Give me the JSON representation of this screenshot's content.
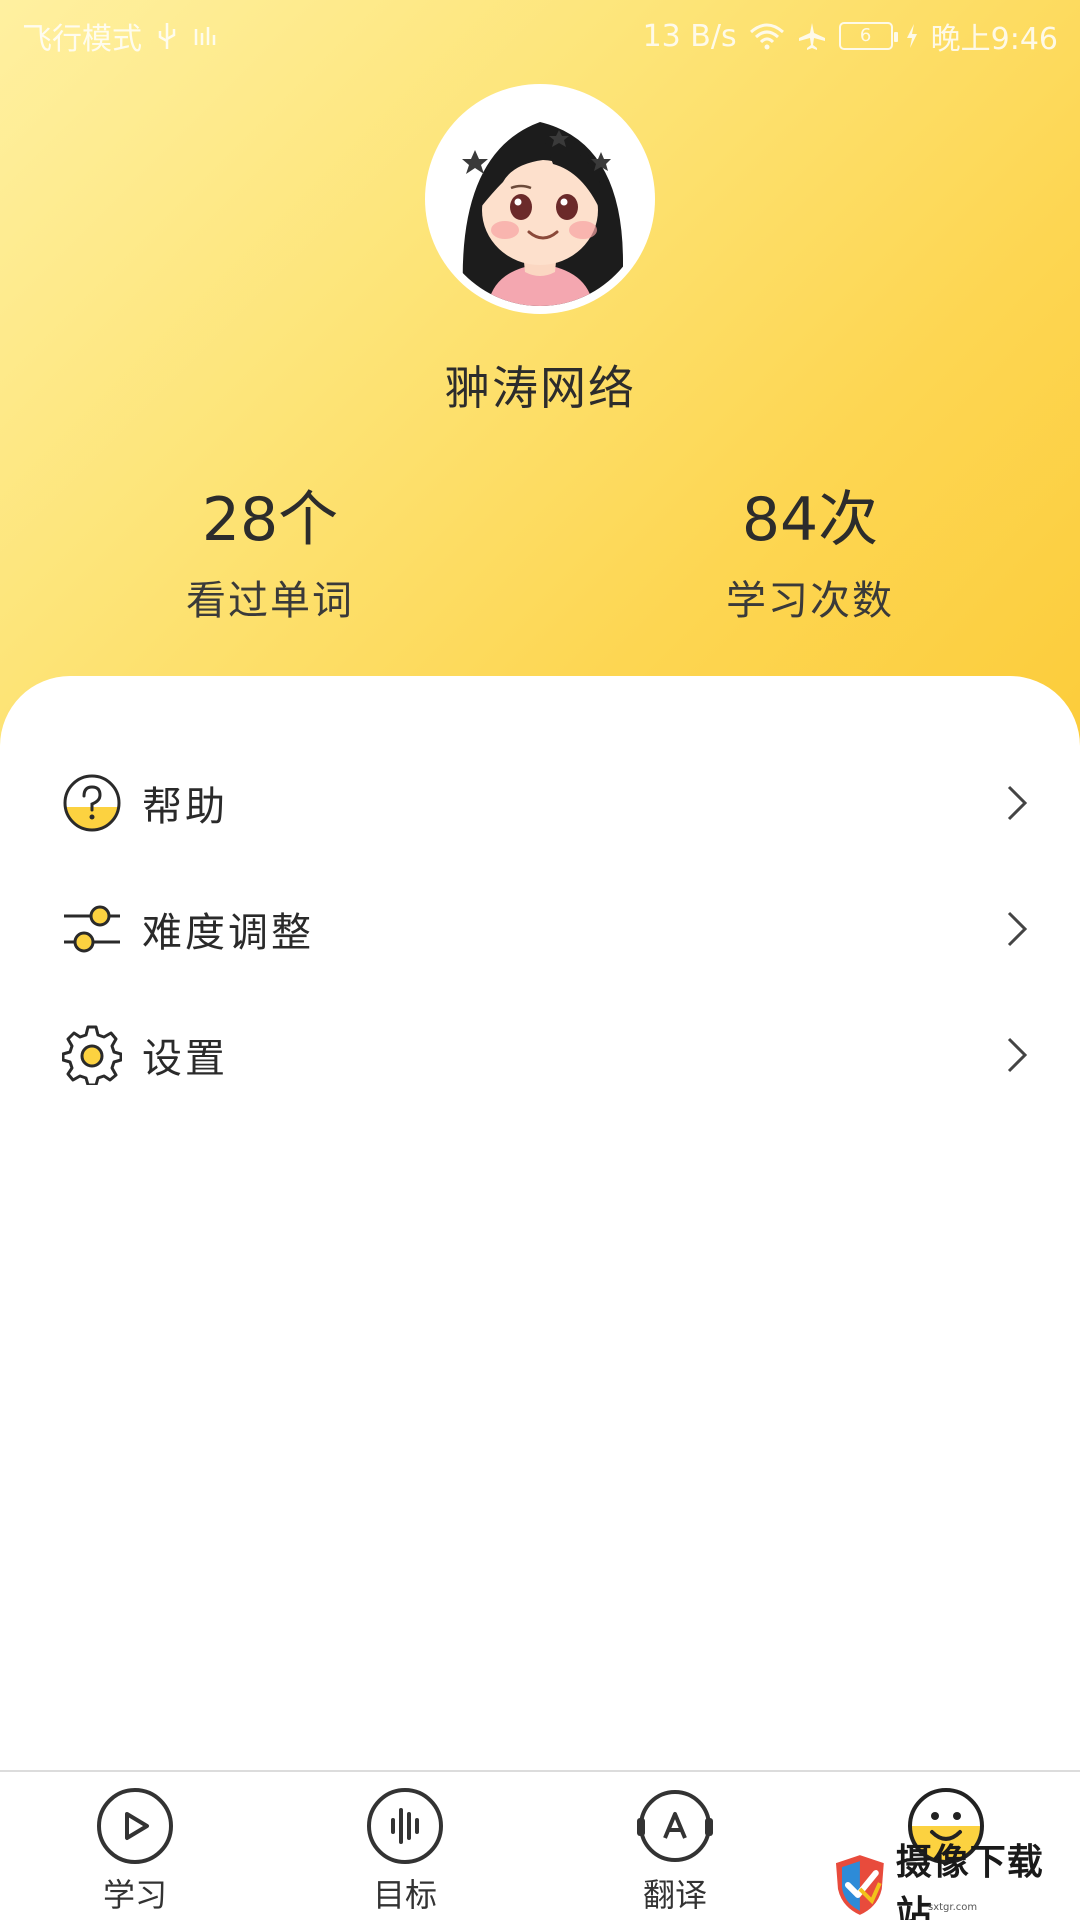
{
  "status_bar": {
    "left_text": "飞行模式",
    "net_speed": "13 B/s",
    "battery": "6",
    "time": "晚上9:46"
  },
  "profile": {
    "username": "翀涛网络"
  },
  "stats": {
    "words_value": "28个",
    "words_label": "看过单词",
    "study_value": "84次",
    "study_label": "学习次数"
  },
  "menu": {
    "help": "帮助",
    "difficulty": "难度调整",
    "settings": "设置"
  },
  "tabs": {
    "study": "学习",
    "goal": "目标",
    "translate": "翻译"
  },
  "watermark": {
    "text": "摄像下载站",
    "sub": "sxtgr.com"
  },
  "colors": {
    "accent": "#fcd240",
    "header_light": "#fff0a0",
    "text": "#2f2f2f"
  }
}
